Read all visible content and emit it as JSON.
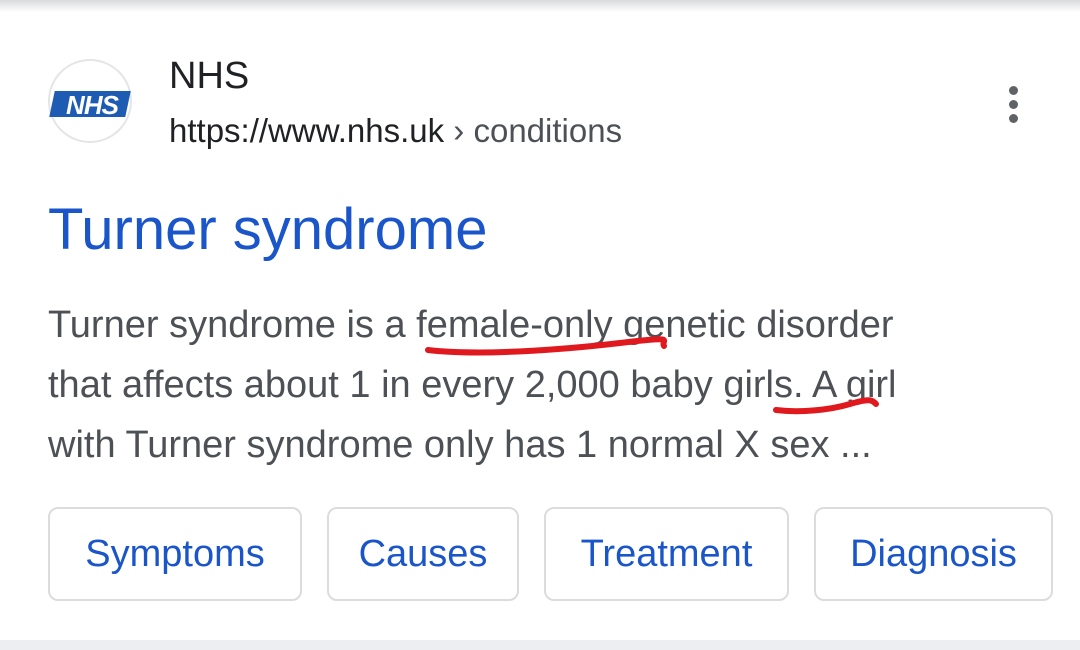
{
  "result": {
    "site_name": "NHS",
    "favicon_text": "NHS",
    "url_base": "https://www.nhs.uk",
    "url_separator": "›",
    "url_crumb": "conditions",
    "title": "Turner syndrome",
    "snippet_lines": [
      "Turner syndrome is a female-only genetic disorder",
      "that affects about 1 in every 2,000 baby girls. A girl",
      "with Turner syndrome only has 1 normal X sex ..."
    ],
    "more_icon": "more-vert-icon"
  },
  "chips": [
    {
      "label": "Symptoms"
    },
    {
      "label": "Causes"
    },
    {
      "label": "Treatment"
    },
    {
      "label": "Diagnosis"
    }
  ],
  "colors": {
    "link_blue": "#1a55c9",
    "snippet_gray": "#4d5156",
    "nhs_blue": "#1e5cb3",
    "annotation_red": "#e0191f"
  },
  "annotations": [
    {
      "type": "red-underline",
      "target": "female-only"
    },
    {
      "type": "red-underline",
      "target": "girls."
    }
  ]
}
